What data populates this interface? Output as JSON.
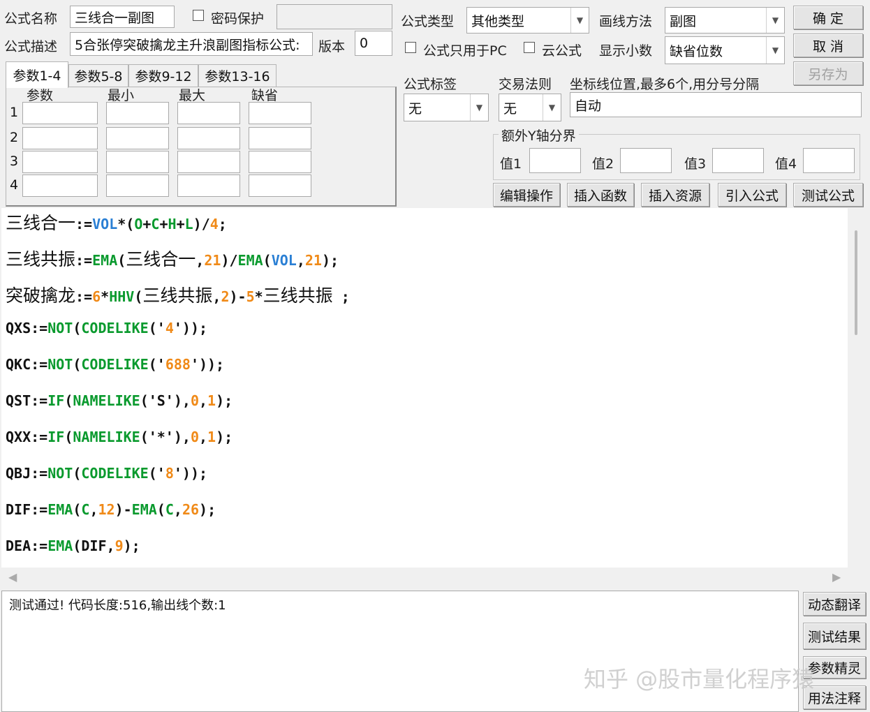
{
  "header": {
    "formula_name_label": "公式名称",
    "formula_name_value": "三线合一副图",
    "password_label": "密码保护",
    "password_value": "",
    "formula_desc_label": "公式描述",
    "formula_desc_value": "5合张停突破擒龙主升浪副图指标公式:",
    "version_label": "版本",
    "version_value": "0"
  },
  "right_panel": {
    "type_label": "公式类型",
    "type_value": "其他类型",
    "draw_label": "画线方法",
    "draw_value": "副图",
    "pc_only_label": "公式只用于PC",
    "cloud_label": "云公式",
    "decimal_label": "显示小数",
    "decimal_value": "缺省位数",
    "tag_label": "公式标签",
    "tag_value": "无",
    "trade_rule_label": "交易法则",
    "trade_rule_value": "无",
    "axis_label": "坐标线位置,最多6个,用分号分隔",
    "axis_value": "自动",
    "extra_y_label": "额外Y轴分界",
    "extra_y": [
      {
        "label": "值1",
        "value": ""
      },
      {
        "label": "值2",
        "value": ""
      },
      {
        "label": "值3",
        "value": ""
      },
      {
        "label": "值4",
        "value": ""
      }
    ]
  },
  "buttons": {
    "ok": "确 定",
    "cancel": "取 消",
    "save_as": "另存为",
    "edit_ops": "编辑操作",
    "insert_func": "插入函数",
    "insert_res": "插入资源",
    "import_formula": "引入公式",
    "test_formula": "测试公式",
    "dyn_translate": "动态翻译",
    "test_result": "测试结果",
    "param_wizard": "参数精灵",
    "usage_notes": "用法注释"
  },
  "params": {
    "tabs": [
      "参数1-4",
      "参数5-8",
      "参数9-12",
      "参数13-16"
    ],
    "columns": [
      "参数",
      "最小",
      "最大",
      "缺省"
    ],
    "rows": [
      "1",
      "2",
      "3",
      "4"
    ]
  },
  "code_lines": [
    [
      {
        "t": "三线合一",
        "c": "cjk"
      },
      {
        "t": ":="
      },
      {
        "t": "VOL",
        "c": "f"
      },
      {
        "t": "*("
      },
      {
        "t": "O",
        "c": "k"
      },
      {
        "t": "+"
      },
      {
        "t": "C",
        "c": "k"
      },
      {
        "t": "+"
      },
      {
        "t": "H",
        "c": "k"
      },
      {
        "t": "+"
      },
      {
        "t": "L",
        "c": "k"
      },
      {
        "t": ")/"
      },
      {
        "t": "4",
        "c": "n"
      },
      {
        "t": ";"
      }
    ],
    [
      {
        "t": "三线共振",
        "c": "cjk"
      },
      {
        "t": ":="
      },
      {
        "t": "EMA",
        "c": "k"
      },
      {
        "t": "("
      },
      {
        "t": "三线合一",
        "c": "cjk"
      },
      {
        "t": ","
      },
      {
        "t": "21",
        "c": "n"
      },
      {
        "t": ")/"
      },
      {
        "t": "EMA",
        "c": "k"
      },
      {
        "t": "("
      },
      {
        "t": "VOL",
        "c": "f"
      },
      {
        "t": ","
      },
      {
        "t": "21",
        "c": "n"
      },
      {
        "t": ");"
      }
    ],
    [
      {
        "t": "突破擒龙",
        "c": "cjk"
      },
      {
        "t": ":="
      },
      {
        "t": "6",
        "c": "n"
      },
      {
        "t": "*"
      },
      {
        "t": "HHV",
        "c": "k"
      },
      {
        "t": "("
      },
      {
        "t": "三线共振",
        "c": "cjk"
      },
      {
        "t": ","
      },
      {
        "t": "2",
        "c": "n"
      },
      {
        "t": ")-"
      },
      {
        "t": "5",
        "c": "n"
      },
      {
        "t": "*"
      },
      {
        "t": "三线共振",
        "c": "cjk"
      },
      {
        "t": " ;"
      }
    ],
    [
      {
        "t": "QXS:="
      },
      {
        "t": "NOT",
        "c": "k"
      },
      {
        "t": "("
      },
      {
        "t": "CODELIKE",
        "c": "k"
      },
      {
        "t": "('"
      },
      {
        "t": "4",
        "c": "s"
      },
      {
        "t": "'));"
      }
    ],
    [
      {
        "t": "QKC:="
      },
      {
        "t": "NOT",
        "c": "k"
      },
      {
        "t": "("
      },
      {
        "t": "CODELIKE",
        "c": "k"
      },
      {
        "t": "('"
      },
      {
        "t": "688",
        "c": "s"
      },
      {
        "t": "'));"
      }
    ],
    [
      {
        "t": "QST:="
      },
      {
        "t": "IF",
        "c": "k"
      },
      {
        "t": "("
      },
      {
        "t": "NAMELIKE",
        "c": "k"
      },
      {
        "t": "('S'),"
      },
      {
        "t": "0",
        "c": "n"
      },
      {
        "t": ","
      },
      {
        "t": "1",
        "c": "n"
      },
      {
        "t": ");"
      }
    ],
    [
      {
        "t": "QXX:="
      },
      {
        "t": "IF",
        "c": "k"
      },
      {
        "t": "("
      },
      {
        "t": "NAMELIKE",
        "c": "k"
      },
      {
        "t": "('*'),"
      },
      {
        "t": "0",
        "c": "n"
      },
      {
        "t": ","
      },
      {
        "t": "1",
        "c": "n"
      },
      {
        "t": ");"
      }
    ],
    [
      {
        "t": "QBJ:="
      },
      {
        "t": "NOT",
        "c": "k"
      },
      {
        "t": "("
      },
      {
        "t": "CODELIKE",
        "c": "k"
      },
      {
        "t": "('"
      },
      {
        "t": "8",
        "c": "s"
      },
      {
        "t": "'));"
      }
    ],
    [
      {
        "t": "DIF:="
      },
      {
        "t": "EMA",
        "c": "k"
      },
      {
        "t": "("
      },
      {
        "t": "C",
        "c": "k"
      },
      {
        "t": ","
      },
      {
        "t": "12",
        "c": "n"
      },
      {
        "t": ")-"
      },
      {
        "t": "EMA",
        "c": "k"
      },
      {
        "t": "("
      },
      {
        "t": "C",
        "c": "k"
      },
      {
        "t": ","
      },
      {
        "t": "26",
        "c": "n"
      },
      {
        "t": ");"
      }
    ],
    [
      {
        "t": "DEA:="
      },
      {
        "t": "EMA",
        "c": "k"
      },
      {
        "t": "(DIF,"
      },
      {
        "t": "9",
        "c": "n"
      },
      {
        "t": ");"
      }
    ]
  ],
  "output_text": "测试通过! 代码长度:516,输出线个数:1",
  "watermark": "知乎 @股市量化程序猿"
}
